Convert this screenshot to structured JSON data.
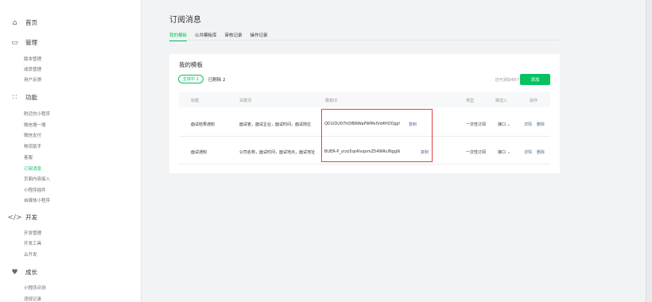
{
  "sidebar": {
    "home": {
      "icon": "home-icon",
      "label": "首页"
    },
    "manage": {
      "icon": "monitor-icon",
      "label": "管理",
      "items": [
        "版本管理",
        "成员管理",
        "用户反馈"
      ]
    },
    "features": {
      "icon": "grid-icon",
      "label": "功能",
      "items": [
        "附近的小程序",
        "微信搜一搜",
        "微信支付",
        "物流助手",
        "客服",
        "订阅消息",
        "页面内容接入",
        "小程序插件",
        "自媒体小程序"
      ],
      "active": "订阅消息"
    },
    "develop": {
      "icon": "code-icon",
      "label": "开发",
      "items": [
        "开发管理",
        "开发工具",
        "云开发"
      ]
    },
    "growth": {
      "icon": "growth-icon",
      "label": "成长",
      "items": [
        "小程序评测",
        "违规记录"
      ]
    }
  },
  "page": {
    "title": "订阅消息",
    "tabs": [
      "我的模板",
      "公共模板库",
      "审核记录",
      "操作记录"
    ],
    "active_tab": "我的模板"
  },
  "card": {
    "title": "我的模板",
    "filter_active": "生效中 2",
    "filter_deleted": "已删除 2",
    "count_hint": "还可添加48个",
    "add_button": "添加",
    "columns": [
      "标题",
      "关键词",
      "模板ID",
      "类型",
      "推送入",
      "操作"
    ],
    "rows": [
      {
        "title": "面试结果通知",
        "keywords": "面试者，面试企业，面试时间，面试岗位",
        "template_id": "QD1lDU07hQfBRWaPWMvlVd4HOOgpS...",
        "copy": "复制",
        "type": "一次性订阅",
        "push": "接口",
        "detail": "详情",
        "delete": "删除"
      },
      {
        "title": "面试通知",
        "keywords": "公司名称，面试时间，面试地点，面试地址",
        "template_id": "BUER-P_yrzo5qnRvqomZ54WRcINggW217...",
        "copy": "复制",
        "type": "一次性订阅",
        "push": "接口",
        "detail": "详情",
        "delete": "删除"
      }
    ]
  },
  "colors": {
    "brand": "#07c160",
    "link": "#576b95",
    "highlight": "#e64340"
  }
}
